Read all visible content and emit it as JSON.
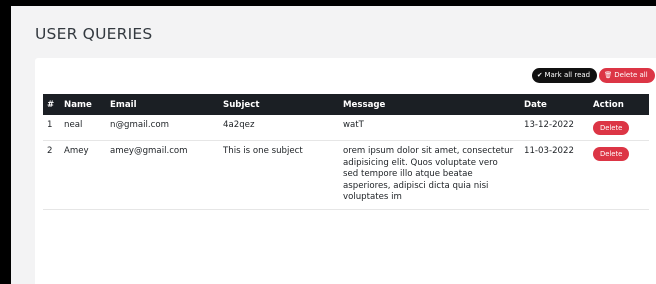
{
  "page": {
    "title": "USER QUERIES"
  },
  "toolbar": {
    "mark_all_read_label": "Mark all read",
    "delete_all_label": "Delete all"
  },
  "table": {
    "headers": [
      "#",
      "Name",
      "Email",
      "Subject",
      "Message",
      "Date",
      "Action"
    ],
    "rows": [
      {
        "index": "1",
        "name": "neal",
        "email": "n@gmail.com",
        "subject": "4a2qez",
        "message": "watT",
        "date": "13-12-2022",
        "action": "Delete"
      },
      {
        "index": "2",
        "name": "Amey",
        "email": "amey@gmail.com",
        "subject": "This is one subject",
        "message": "orem ipsum dolor sit amet, consectetur adipisicing elit. Quos voluptate vero sed tempore illo atque beatae asperiores, adipisci dicta quia nisi voluptates im",
        "date": "11-03-2022",
        "action": "Delete"
      }
    ]
  },
  "colors": {
    "danger": "#dc3545",
    "dark": "#111111",
    "header_bg": "#1b1f24",
    "page_bg": "#f3f3f4"
  },
  "icons": {
    "mark_all_read": "check-double-icon",
    "delete_all": "trash-icon"
  }
}
